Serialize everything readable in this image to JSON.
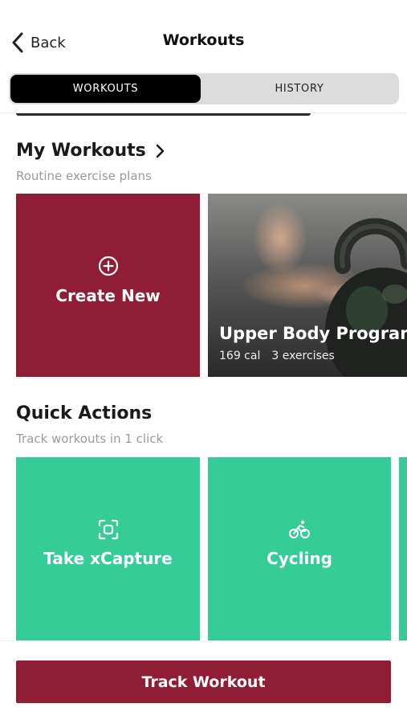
{
  "nav": {
    "back_label": "Back",
    "title": "Workouts"
  },
  "tabs": [
    {
      "label": "WORKOUTS",
      "active": true
    },
    {
      "label": "HISTORY",
      "active": false
    }
  ],
  "my_workouts": {
    "title": "My Workouts",
    "subtitle": "Routine exercise plans",
    "create_card": {
      "label": "Create New",
      "icon": "plus-circle-icon"
    },
    "program_card": {
      "title": "Upper Body Program",
      "calories": "169 cal",
      "exercises": "3 exercises"
    }
  },
  "quick_actions": {
    "title": "Quick Actions",
    "subtitle": "Track workouts in 1 click",
    "items": [
      {
        "label": "Take xCapture",
        "icon": "capture-icon"
      },
      {
        "label": "Cycling",
        "icon": "bicycle-icon"
      }
    ]
  },
  "footer": {
    "button_label": "Track Workout"
  },
  "colors": {
    "brand_red": "#8f1d35",
    "quick_green": "#35cc97",
    "segment_bg": "#dcdcdc",
    "subtitle_gray": "#9a9a9a"
  }
}
